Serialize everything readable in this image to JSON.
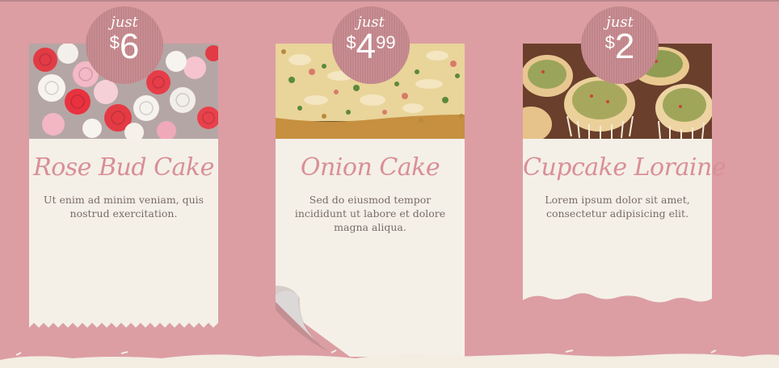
{
  "cards": [
    {
      "just": "just",
      "currency": "$",
      "price_main": "6",
      "price_cents": "",
      "title": "Rose Bud Cake",
      "description": "Ut enim ad minim veniam, quis nostrud exercitation."
    },
    {
      "just": "just",
      "currency": "$",
      "price_main": "4",
      "price_cents": "99",
      "title": "Onion Cake",
      "description": "Sed do eiusmod tempor incididunt ut labore et dolore magna aliqua."
    },
    {
      "just": "just",
      "currency": "$",
      "price_main": "2",
      "price_cents": "",
      "title": "Cupcake Loraine",
      "description": "Lorem ipsum dolor sit amet, consectetur adipisicing elit."
    }
  ],
  "colors": {
    "background": "#dc9ea3",
    "card": "#f4f0e8",
    "badge": "#c88a8f",
    "title": "#d98f96",
    "text": "#7a6a68"
  }
}
